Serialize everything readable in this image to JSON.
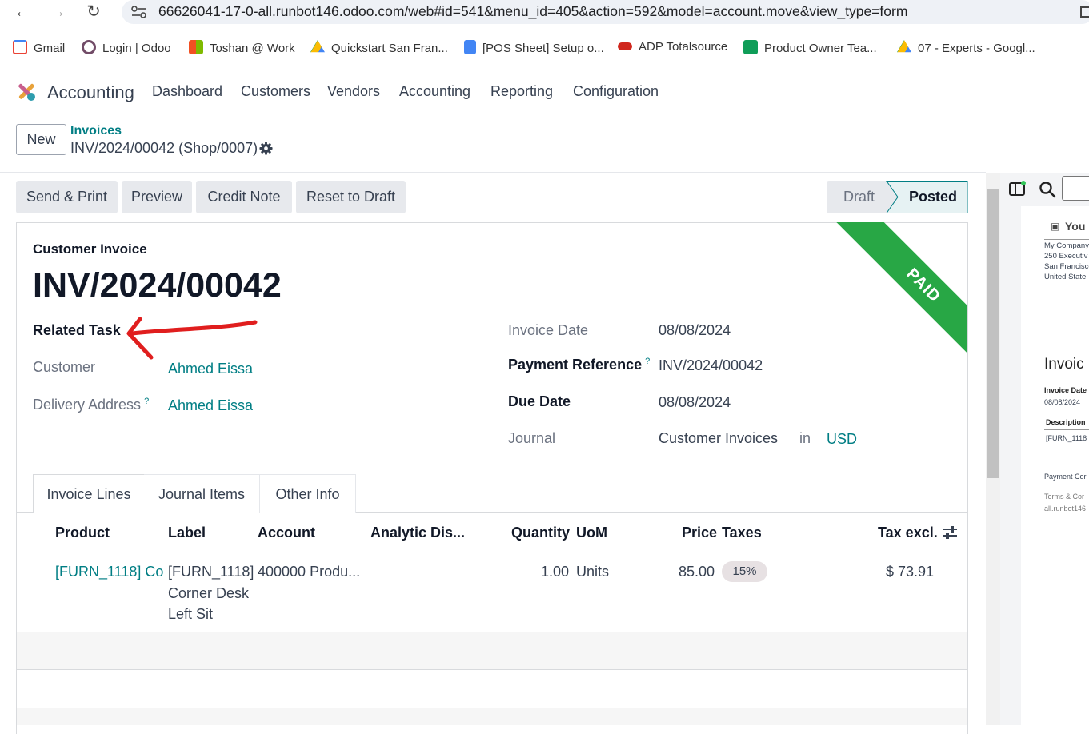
{
  "browser": {
    "url": "66626041-17-0-all.runbot146.odoo.com/web#id=541&menu_id=405&action=592&model=account.move&view_type=form",
    "bookmarks": [
      {
        "label": "Gmail",
        "icon": "gmail-icon",
        "color": "#ea4335"
      },
      {
        "label": "Login | Odoo",
        "icon": "odoo-icon",
        "color": "#714b67"
      },
      {
        "label": "Toshan @ Work",
        "icon": "microsoft-icon",
        "color": "#f25022"
      },
      {
        "label": "Quickstart San Fran...",
        "icon": "google-drive-icon",
        "color": "#fbbc04"
      },
      {
        "label": "[POS Sheet] Setup o...",
        "icon": "google-docs-icon",
        "color": "#4285f4"
      },
      {
        "label": "ADP Totalsource",
        "icon": "adp-icon",
        "color": "#d0271d"
      },
      {
        "label": "Product Owner Tea...",
        "icon": "google-sheets-icon",
        "color": "#0f9d58"
      },
      {
        "label": "07 - Experts - Googl...",
        "icon": "google-drive-icon",
        "color": "#fbbc04"
      }
    ]
  },
  "app": {
    "name": "Accounting",
    "menu": [
      "Dashboard",
      "Customers",
      "Vendors",
      "Accounting",
      "Reporting",
      "Configuration"
    ]
  },
  "control": {
    "new_label": "New",
    "breadcrumb_parent": "Invoices",
    "breadcrumb_current": "INV/2024/00042 (Shop/0007)"
  },
  "actions": [
    "Send & Print",
    "Preview",
    "Credit Note",
    "Reset to Draft"
  ],
  "status": {
    "draft": "Draft",
    "posted": "Posted"
  },
  "ribbon": "PAID",
  "invoice": {
    "type_label": "Customer Invoice",
    "number": "INV/2024/00042",
    "related_task_label": "Related Task",
    "customer_label": "Customer",
    "customer": "Ahmed Eissa",
    "delivery_label": "Delivery Address",
    "delivery": "Ahmed Eissa",
    "invoice_date_label": "Invoice Date",
    "invoice_date": "08/08/2024",
    "payment_ref_label": "Payment Reference",
    "payment_ref": "INV/2024/00042",
    "due_date_label": "Due Date",
    "due_date": "08/08/2024",
    "journal_label": "Journal",
    "journal": "Customer Invoices",
    "in_label": "in",
    "currency": "USD",
    "help_mark": "?"
  },
  "tabs": [
    "Invoice Lines",
    "Journal Items",
    "Other Info"
  ],
  "lines": {
    "headers": {
      "product": "Product",
      "label": "Label",
      "account": "Account",
      "analytic": "Analytic Dis...",
      "quantity": "Quantity",
      "uom": "UoM",
      "price": "Price",
      "taxes": "Taxes",
      "tax_excl": "Tax excl."
    },
    "row": {
      "product": "[FURN_1118] Corı",
      "label_1": "[FURN_1118]",
      "label_2": "Corner Desk",
      "label_3": "Left Sit",
      "account": "400000 Produ...",
      "quantity": "1.00",
      "uom": "Units",
      "price": "85.00",
      "tax": "15%",
      "subtotal": "$ 73.91"
    }
  },
  "preview": {
    "title": "You",
    "company_1": "My Company",
    "company_2": "250 Executiv",
    "company_3": "San Francisco",
    "company_4": "United State",
    "heading": "Invoic",
    "date_label": "Invoice Date",
    "date": "08/08/2024",
    "desc_label": "Description",
    "desc": "[FURN_1118",
    "payment": "Payment Cor",
    "terms": "Terms & Cor",
    "domain": "all.runbot146"
  },
  "colors": {
    "accent": "#017e84",
    "ribbon": "#28a745",
    "annotation": "#e01e1e"
  }
}
